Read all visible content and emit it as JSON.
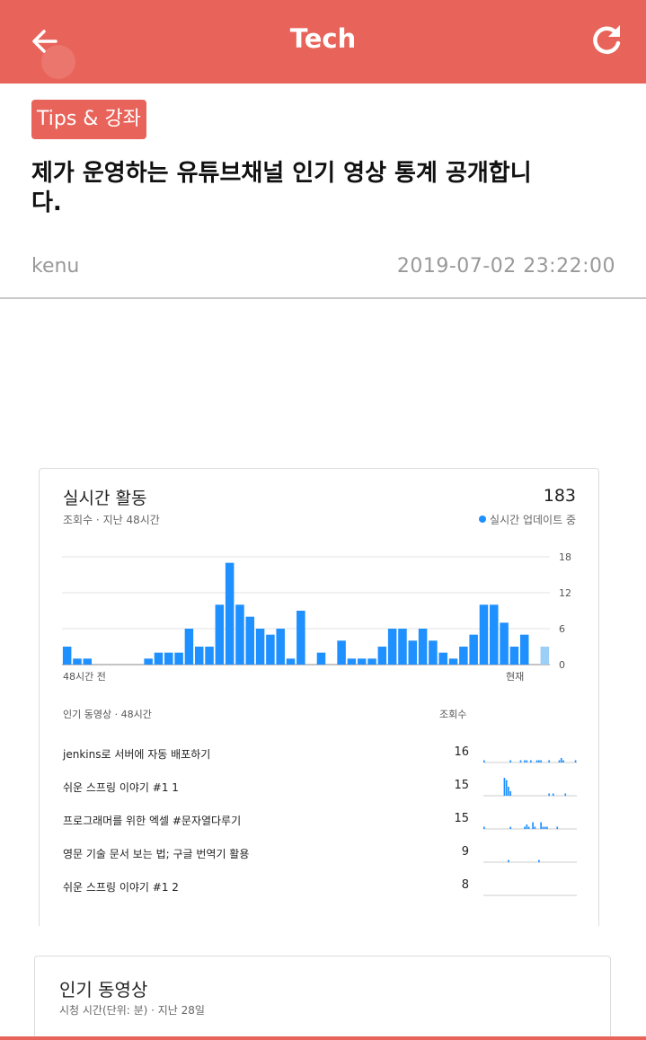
{
  "app_bar": {
    "title": "Tech",
    "back_icon": "arrow-left-icon",
    "refresh_icon": "refresh-icon",
    "color": "#e8635a"
  },
  "post": {
    "category": "Tips & 강좌",
    "title": "제가 운영하는 유튜브채널 인기 영상 통계 공개합니다.",
    "author": "kenu",
    "date": "2019-07-02 23:22:00"
  },
  "realtime_card": {
    "title": "실시간 활동",
    "total": "183",
    "subtitle": "조회수 · 지난 48시간",
    "live_label": "실시간 업데이트 중",
    "x_start_label": "48시간 전",
    "x_end_label": "현재",
    "list_header_left": "인기 동영상 · 48시간",
    "list_header_right": "조회수",
    "videos": [
      {
        "title": "jenkins로 서버에 자동 배포하기",
        "views": "16"
      },
      {
        "title": "쉬운 스프링 이야기 #1 1",
        "views": "15"
      },
      {
        "title": "프로그래머를 위한 엑셀 #문자열다루기",
        "views": "15"
      },
      {
        "title": "영문 기술 문서 보는 법; 구글 번역기 활용",
        "views": "9"
      },
      {
        "title": "쉬운 스프링 이야기 #1 2",
        "views": "8"
      }
    ]
  },
  "chart_data": {
    "type": "bar",
    "title": "실시간 활동",
    "subtitle": "조회수 · 지난 48시간",
    "xlabel": "",
    "ylabel": "",
    "ylim": [
      0,
      18
    ],
    "yticks": [
      "0",
      "6",
      "12",
      "18"
    ],
    "grid": true,
    "values": [
      3,
      1,
      1,
      0,
      0,
      0,
      0,
      0,
      1,
      2,
      2,
      2,
      6,
      3,
      3,
      10,
      17,
      10,
      8,
      6,
      5,
      6,
      1,
      9,
      0,
      2,
      0,
      4,
      1,
      1,
      1,
      3,
      6,
      6,
      4,
      6,
      4,
      2,
      1,
      3,
      5,
      10,
      10,
      7,
      3,
      5,
      0,
      3
    ],
    "last_bar_partial": true,
    "colors": {
      "bar": "#1e90ff",
      "partial_bar": "#9ccff7"
    }
  },
  "sparklines": [
    [
      1,
      0,
      0,
      0,
      0,
      0,
      0,
      0,
      0,
      0,
      0,
      0,
      0,
      1,
      0,
      0,
      0,
      0,
      1,
      0,
      1,
      1,
      0,
      1,
      0,
      0,
      1,
      1,
      1,
      0,
      0,
      0,
      1,
      0,
      0,
      0,
      0,
      1,
      2,
      1,
      0,
      0,
      0,
      0,
      0,
      1
    ],
    [
      0,
      0,
      0,
      0,
      0,
      0,
      0,
      0,
      0,
      0,
      8,
      7,
      4,
      2,
      0,
      0,
      0,
      0,
      0,
      0,
      0,
      0,
      0,
      0,
      0,
      0,
      0,
      0,
      0,
      0,
      0,
      0,
      1,
      0,
      1,
      0,
      0,
      0,
      0,
      0,
      1,
      0,
      0,
      0,
      0,
      0
    ],
    [
      1,
      0,
      0,
      0,
      0,
      0,
      0,
      0,
      0,
      0,
      0,
      0,
      0,
      1,
      0,
      0,
      0,
      0,
      0,
      0,
      1,
      2,
      1,
      0,
      3,
      1,
      0,
      0,
      3,
      1,
      1,
      1,
      0,
      0,
      0,
      0,
      1,
      0,
      0,
      0,
      0,
      0,
      0,
      0,
      0,
      0
    ],
    [
      0,
      0,
      0,
      0,
      0,
      0,
      0,
      0,
      0,
      0,
      0,
      0,
      1,
      0,
      0,
      0,
      0,
      0,
      0,
      0,
      0,
      0,
      0,
      0,
      0,
      0,
      0,
      1,
      0,
      0,
      0,
      0,
      0,
      0,
      0,
      0,
      0,
      0,
      0,
      0,
      0,
      0,
      0,
      0,
      0,
      0
    ],
    [
      0,
      0,
      0,
      0,
      0,
      0,
      0,
      0,
      0,
      0,
      0,
      0,
      0,
      0,
      0,
      0,
      0,
      0,
      0,
      0,
      0,
      0,
      0,
      0,
      0,
      0,
      0,
      0,
      0,
      0,
      0,
      0,
      0,
      0,
      0,
      0,
      0,
      0,
      0,
      0,
      0,
      0,
      0,
      0,
      0,
      0
    ]
  ],
  "popular_card": {
    "title": "인기 동영상",
    "subtitle": "시청 시간(단위: 분) · 지난 28일"
  }
}
